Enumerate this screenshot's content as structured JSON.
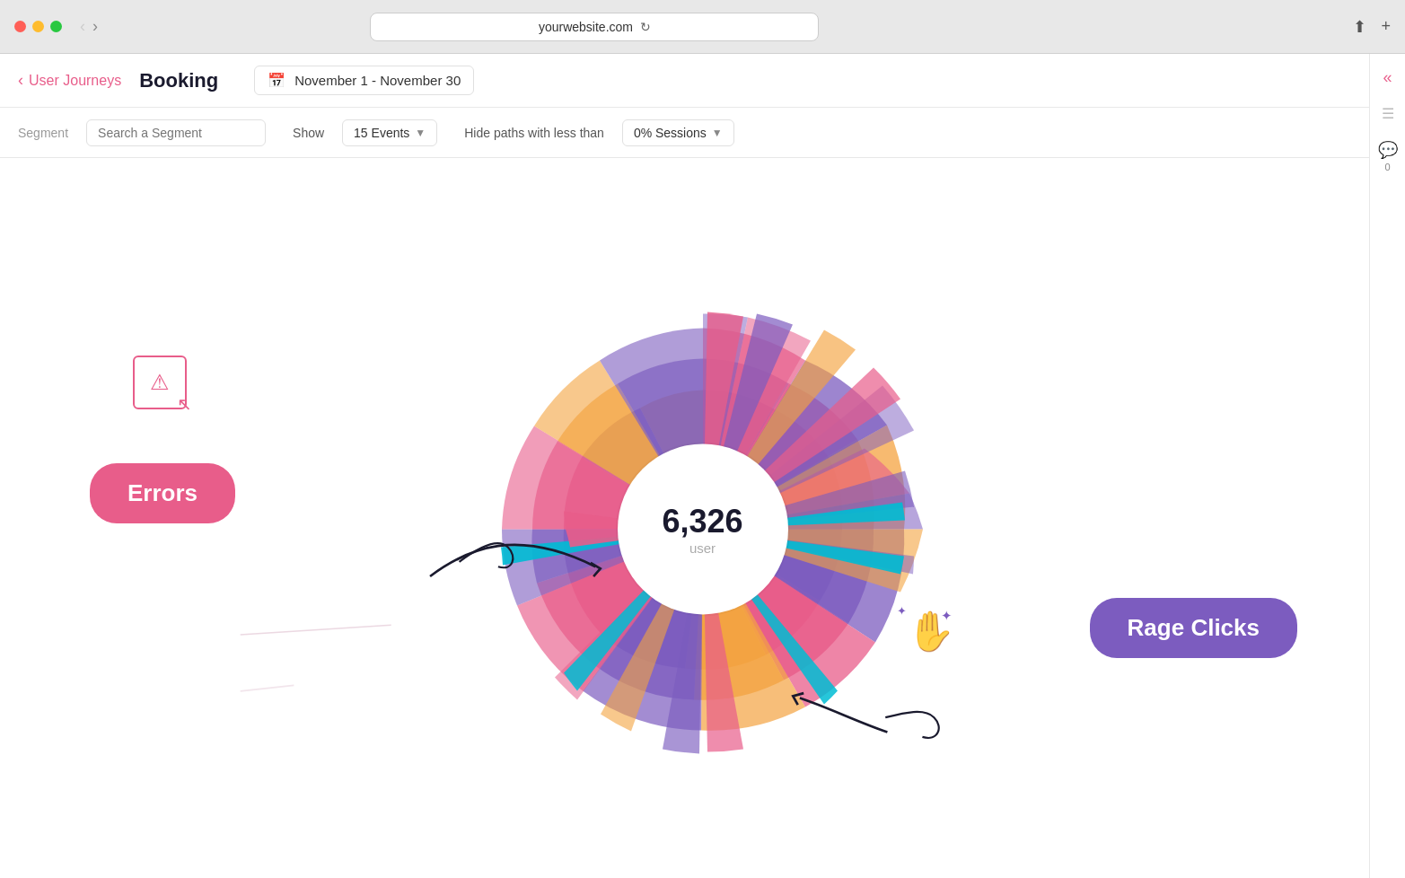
{
  "browser": {
    "url": "yourwebsite.com",
    "back_disabled": true,
    "forward_disabled": false
  },
  "header": {
    "breadcrumb_label": "User Journeys",
    "page_title": "Booking",
    "date_range": "November 1 - November 30"
  },
  "toolbar": {
    "segment_label": "Segment",
    "segment_placeholder": "Search a Segment",
    "show_label": "Show",
    "events_dropdown": "15 Events",
    "hide_paths_label": "Hide paths with less than",
    "sessions_dropdown": "0% Sessions"
  },
  "chart": {
    "center_number": "6,326",
    "center_label": "user"
  },
  "callouts": {
    "errors_label": "Errors",
    "rage_clicks_label": "Rage Clicks"
  },
  "right_sidebar": {
    "comment_count": "0"
  }
}
